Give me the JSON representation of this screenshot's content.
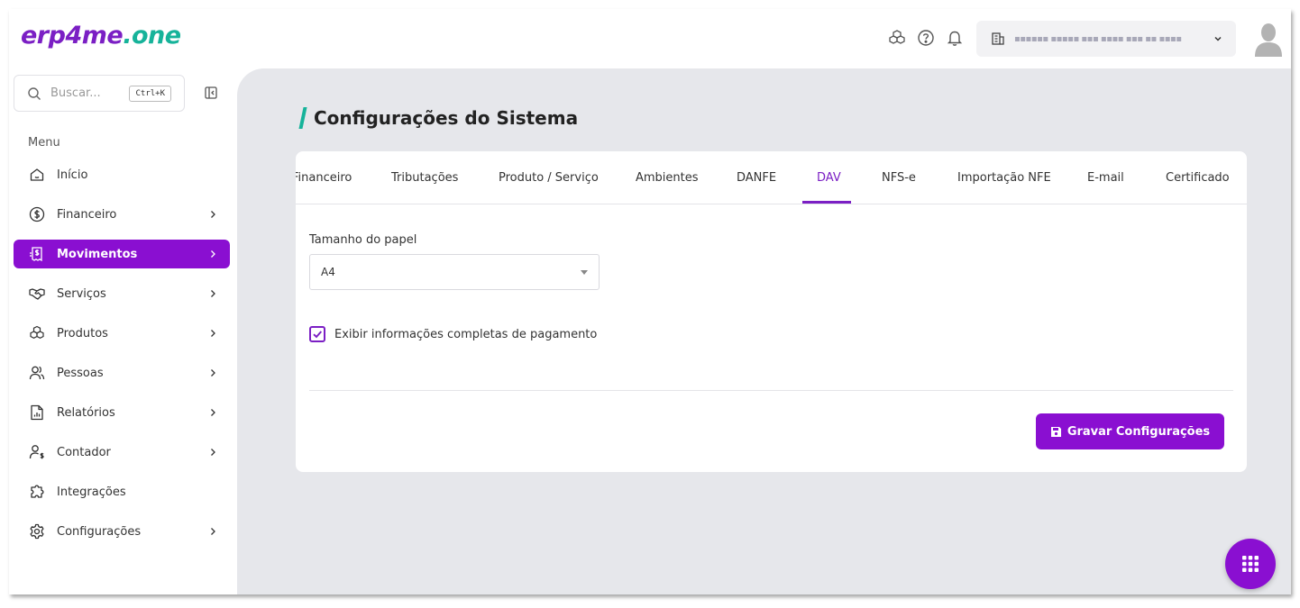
{
  "brand": {
    "logo_part1": "erp4me",
    "logo_part2": ".one",
    "primary": "#8a0fd1",
    "accent": "#16b39a"
  },
  "topbar": {
    "icons": [
      "apps-cubes-icon",
      "help-icon",
      "bell-icon"
    ],
    "company": {
      "icon": "building-icon",
      "name": "▪▪▪▪▪▪ ▪▪▪▪▪ ▪▪▪ ▪▪▪▪ ▪▪▪ ▪▪ ▪▪▪▪",
      "chevron": "chevron-down-icon"
    },
    "avatar": "user-avatar"
  },
  "sidebar": {
    "search": {
      "placeholder": "Buscar...",
      "shortcut": "Ctrl+K"
    },
    "menu_title": "Menu",
    "items": [
      {
        "label": "Início",
        "icon": "home-icon",
        "has_submenu": false,
        "active": false
      },
      {
        "label": "Financeiro",
        "icon": "dollar-circle-icon",
        "has_submenu": true,
        "active": false
      },
      {
        "label": "Movimentos",
        "icon": "receipt-icon",
        "has_submenu": true,
        "active": true
      },
      {
        "label": "Serviços",
        "icon": "handshake-icon",
        "has_submenu": true,
        "active": false
      },
      {
        "label": "Produtos",
        "icon": "boxes-icon",
        "has_submenu": true,
        "active": false
      },
      {
        "label": "Pessoas",
        "icon": "users-icon",
        "has_submenu": true,
        "active": false
      },
      {
        "label": "Relatórios",
        "icon": "report-icon",
        "has_submenu": true,
        "active": false
      },
      {
        "label": "Contador",
        "icon": "accountant-icon",
        "has_submenu": true,
        "active": false
      },
      {
        "label": "Integrações",
        "icon": "puzzle-icon",
        "has_submenu": false,
        "active": false
      },
      {
        "label": "Configurações",
        "icon": "gear-icon",
        "has_submenu": true,
        "active": false
      }
    ]
  },
  "main": {
    "title": "Configurações do Sistema",
    "tabs": [
      {
        "label": "Financeiro",
        "active": false
      },
      {
        "label": "Tributações",
        "active": false
      },
      {
        "label": "Produto / Serviço",
        "active": false
      },
      {
        "label": "Ambientes",
        "active": false
      },
      {
        "label": "DANFE",
        "active": false
      },
      {
        "label": "DAV",
        "active": true
      },
      {
        "label": "NFS-e",
        "active": false
      },
      {
        "label": "Importação NFE",
        "active": false
      },
      {
        "label": "E-mail",
        "active": false
      },
      {
        "label": "Certificado",
        "active": false
      }
    ],
    "paper_size": {
      "label": "Tamanho do papel",
      "value": "A4"
    },
    "show_payment": {
      "label": "Exibir informações completas de pagamento",
      "checked": true
    },
    "save_button": {
      "label": "Gravar Configurações",
      "icon": "floppy-disk-icon"
    }
  },
  "fab": {
    "icon": "grid-dots-icon"
  }
}
